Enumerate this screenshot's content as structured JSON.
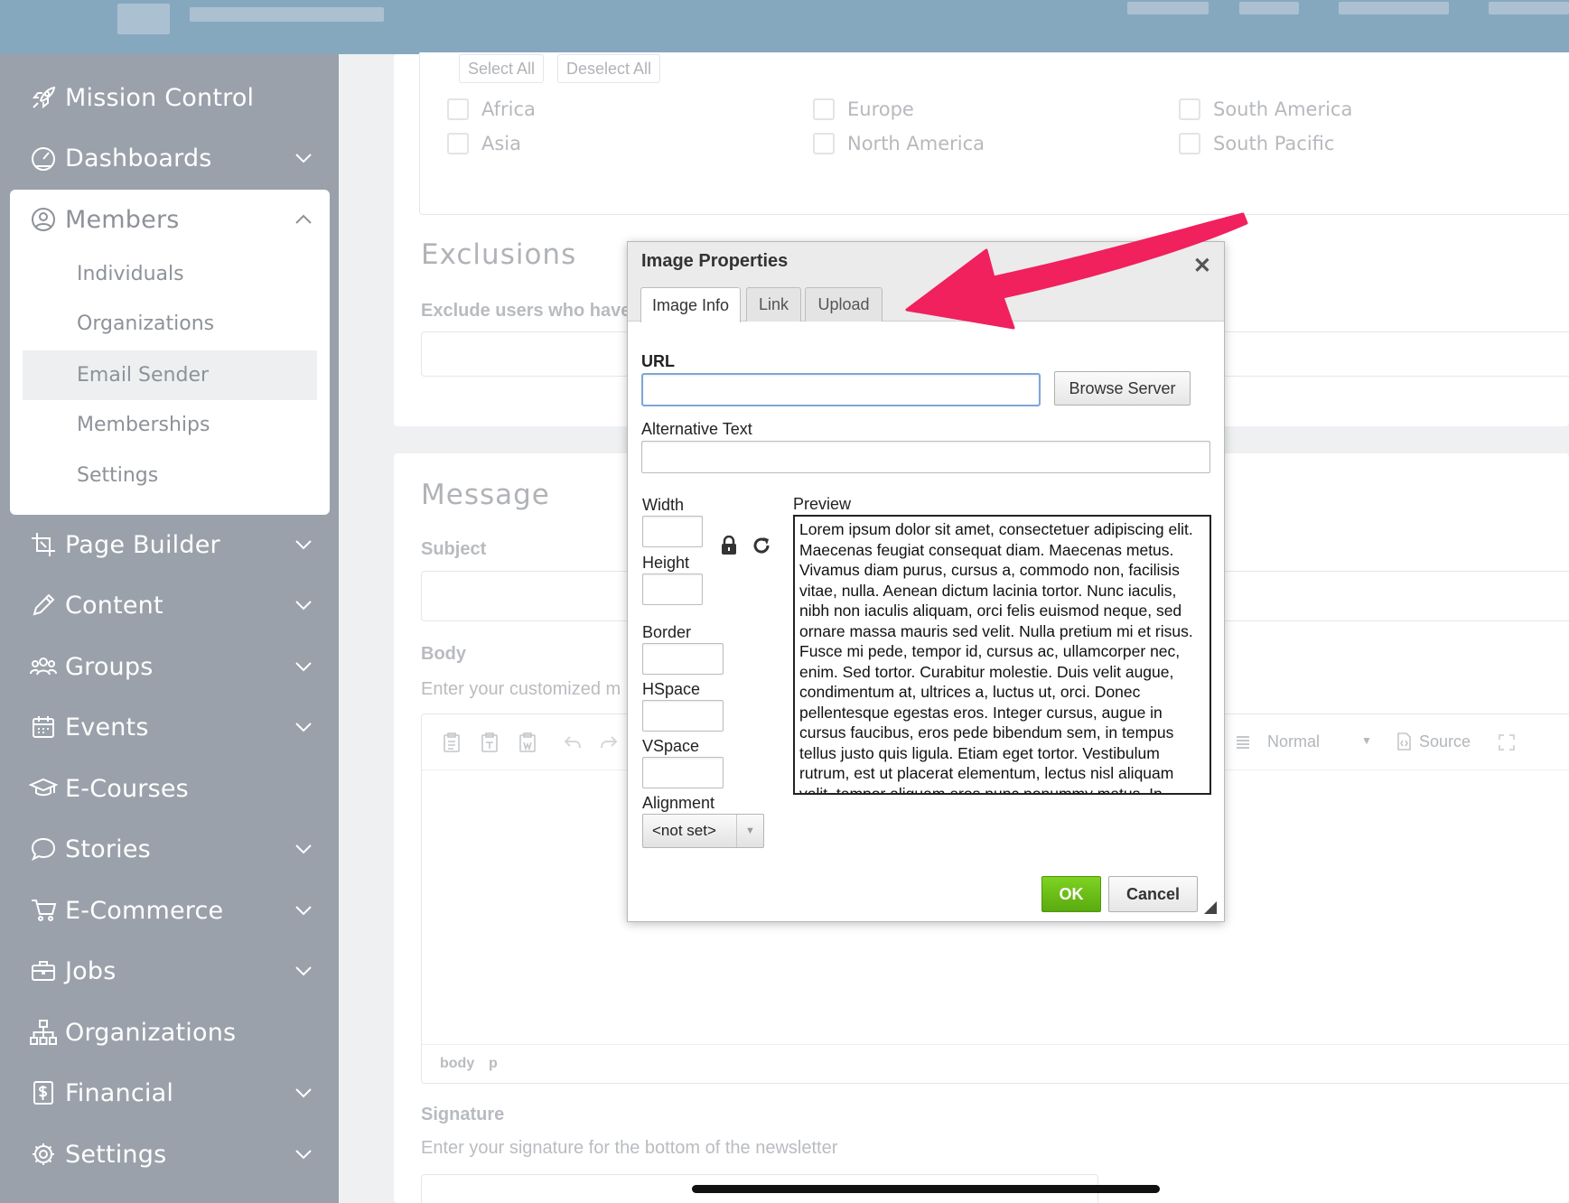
{
  "sidebar": {
    "items": [
      {
        "label": "Mission Control",
        "icon": "rocket-icon",
        "chevron": false
      },
      {
        "label": "Dashboards",
        "icon": "gauge-icon",
        "chevron": true
      },
      {
        "label": "Members",
        "icon": "user-circle-icon",
        "chevron": true,
        "expanded": true
      },
      {
        "label": "Page Builder",
        "icon": "crop-icon",
        "chevron": true
      },
      {
        "label": "Content",
        "icon": "pencil-icon",
        "chevron": true
      },
      {
        "label": "Groups",
        "icon": "users-icon",
        "chevron": true
      },
      {
        "label": "Events",
        "icon": "calendar-icon",
        "chevron": true
      },
      {
        "label": "E-Courses",
        "icon": "graduation-cap-icon",
        "chevron": false
      },
      {
        "label": "Stories",
        "icon": "speech-bubble-icon",
        "chevron": true
      },
      {
        "label": "E-Commerce",
        "icon": "cart-icon",
        "chevron": true
      },
      {
        "label": "Jobs",
        "icon": "briefcase-icon",
        "chevron": true
      },
      {
        "label": "Organizations",
        "icon": "org-chart-icon",
        "chevron": false
      },
      {
        "label": "Financial",
        "icon": "dollar-doc-icon",
        "chevron": true
      },
      {
        "label": "Settings",
        "icon": "gear-icon",
        "chevron": true
      }
    ],
    "members_sub": [
      "Individuals",
      "Organizations",
      "Email Sender",
      "Memberships",
      "Settings"
    ],
    "active_sub": "Email Sender"
  },
  "regions": {
    "select_all": "Select All",
    "deselect_all": "Deselect All",
    "items": [
      "Africa",
      "Europe",
      "South America",
      "Asia",
      "North America",
      "South Pacific"
    ]
  },
  "exclusions": {
    "title": "Exclusions",
    "label": "Exclude users who have"
  },
  "message": {
    "title": "Message",
    "subject_label": "Subject",
    "body_label": "Body",
    "body_hint": "Enter your customized m",
    "format_value": "Normal",
    "source_label": "Source",
    "path": [
      "body",
      "p"
    ],
    "signature_label": "Signature",
    "signature_hint": "Enter your signature for the bottom of the newsletter"
  },
  "dialog": {
    "title": "Image Properties",
    "close": "✕",
    "tabs": [
      "Image Info",
      "Link",
      "Upload"
    ],
    "url_label": "URL",
    "url_value": "",
    "browse_button": "Browse Server",
    "alt_label": "Alternative Text",
    "width_label": "Width",
    "height_label": "Height",
    "border_label": "Border",
    "hspace_label": "HSpace",
    "vspace_label": "VSpace",
    "alignment_label": "Alignment",
    "alignment_value": "<not set>",
    "preview_label": "Preview",
    "preview_text": "Lorem ipsum dolor sit amet, consectetuer adipiscing elit. Maecenas feugiat consequat diam. Maecenas metus. Vivamus diam purus, cursus a, commodo non, facilisis vitae, nulla. Aenean dictum lacinia tortor. Nunc iaculis, nibh non iaculis aliquam, orci felis euismod neque, sed ornare massa mauris sed velit. Nulla pretium mi et risus. Fusce mi pede, tempor id, cursus ac, ullamcorper nec, enim. Sed tortor. Curabitur molestie. Duis velit augue, condimentum at, ultrices a, luctus ut, orci. Donec pellentesque egestas eros. Integer cursus, augue in cursus faucibus, eros pede bibendum sem, in tempus tellus justo quis ligula. Etiam eget tortor. Vestibulum rutrum, est ut placerat elementum, lectus nisl aliquam velit, tempor aliquam eros nunc nonummy metus. In",
    "ok": "OK",
    "cancel": "Cancel"
  },
  "colors": {
    "sidebar": "#9aa1aa",
    "topbar": "#86a8bf",
    "ok_green": "#6cc21a",
    "arrow": "#f0215d"
  }
}
